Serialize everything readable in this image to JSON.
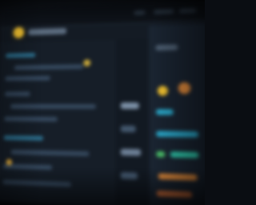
{
  "colors": {
    "background": "#0a0d12",
    "panel": "#141b24",
    "sidebar": "#161e28",
    "accent_yellow": "#f2c230",
    "accent_orange": "#e08a3c",
    "accent_cyan": "#2aa7c9",
    "accent_teal": "#2ec4a8",
    "accent_green": "#4cc36b"
  },
  "icons": {
    "logo": "app-logo-icon",
    "nav": [
      "sidebar-nav-icon"
    ],
    "widgets": [
      "status-yellow-icon",
      "status-orange-icon"
    ]
  },
  "rendering_note_visible_text": ""
}
